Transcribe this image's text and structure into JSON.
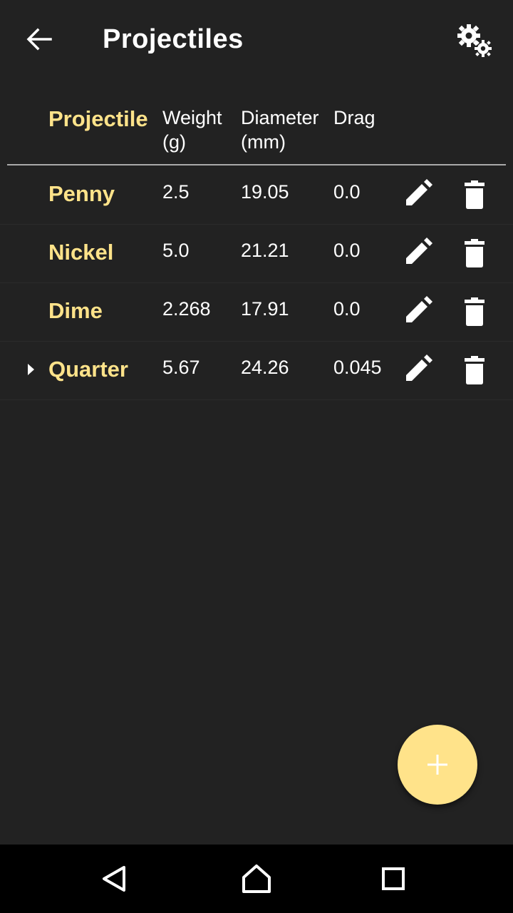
{
  "app_bar": {
    "title": "Projectiles",
    "back_icon": "arrow-left-icon",
    "settings_icon": "gears-icon"
  },
  "table": {
    "headers": {
      "projectile": "Projectile",
      "weight": "Weight\n(g)",
      "diameter": "Diameter\n(mm)",
      "drag": "Drag"
    },
    "rows": [
      {
        "name": "Penny",
        "weight": "2.5",
        "diameter": "19.05",
        "drag": "0.0",
        "selected": false
      },
      {
        "name": "Nickel",
        "weight": "5.0",
        "diameter": "21.21",
        "drag": "0.0",
        "selected": false
      },
      {
        "name": "Dime",
        "weight": "2.268",
        "diameter": "17.91",
        "drag": "0.0",
        "selected": false
      },
      {
        "name": "Quarter",
        "weight": "5.67",
        "diameter": "24.26",
        "drag": "0.045",
        "selected": true
      }
    ]
  },
  "fab": {
    "icon": "plus-icon"
  },
  "navbar": {
    "icons": [
      "nav-back-icon",
      "nav-home-icon",
      "nav-recents-icon"
    ]
  },
  "colors": {
    "background": "#222222",
    "accent": "#ffe38a",
    "text": "#ffffff",
    "navbar": "#000000"
  }
}
